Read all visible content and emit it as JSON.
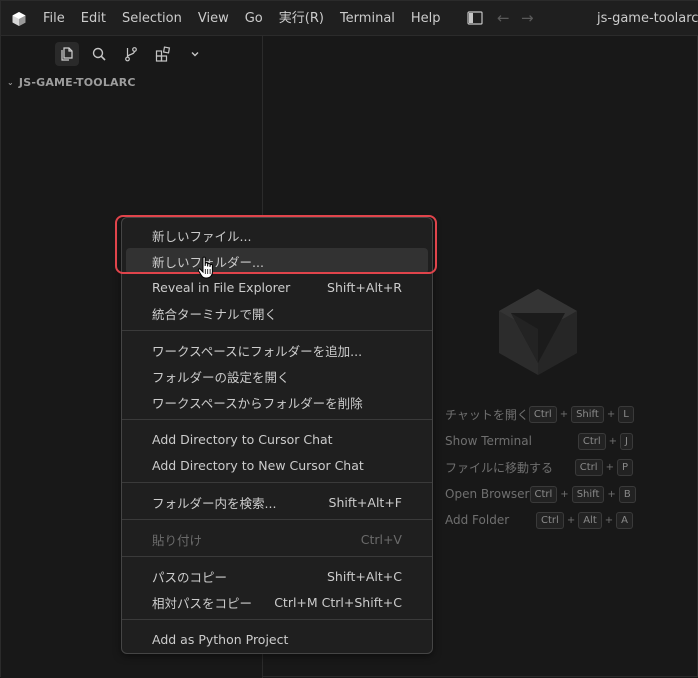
{
  "titlebar": {
    "menu": [
      "File",
      "Edit",
      "Selection",
      "View",
      "Go",
      "実行(R)",
      "Terminal",
      "Help"
    ],
    "back_arrow": "←",
    "forward_arrow": "→",
    "window_title": "js-game-toolarc"
  },
  "sidebar": {
    "activity_icons": [
      "explorer-icon",
      "search-icon",
      "source-control-icon",
      "extensions-icon",
      "chevron-down-icon"
    ],
    "explorer_title": "JS-GAME-TOOLARC",
    "explorer_chevron": "⌄"
  },
  "editor": {
    "shortcuts": [
      {
        "label": "チャットを開く",
        "keys": [
          "Ctrl",
          "Shift",
          "L"
        ]
      },
      {
        "label": "Show Terminal",
        "keys": [
          "Ctrl",
          "J"
        ]
      },
      {
        "label": "ファイルに移動する",
        "keys": [
          "Ctrl",
          "P"
        ]
      },
      {
        "label": "Open Browser",
        "keys": [
          "Ctrl",
          "Shift",
          "B"
        ]
      },
      {
        "label": "Add Folder",
        "keys": [
          "Ctrl",
          "Alt",
          "A"
        ]
      }
    ]
  },
  "context_menu": {
    "items": [
      {
        "label": "新しいファイル...",
        "shortcut": ""
      },
      {
        "label": "新しいフォルダー...",
        "shortcut": ""
      },
      {
        "label": "Reveal in File Explorer",
        "shortcut": "Shift+Alt+R"
      },
      {
        "label": "統合ターミナルで開く",
        "shortcut": ""
      },
      {
        "label": "ワークスペースにフォルダーを追加...",
        "shortcut": ""
      },
      {
        "label": "フォルダーの設定を開く",
        "shortcut": ""
      },
      {
        "label": "ワークスペースからフォルダーを削除",
        "shortcut": ""
      },
      {
        "label": "Add Directory to Cursor Chat",
        "shortcut": ""
      },
      {
        "label": "Add Directory to New Cursor Chat",
        "shortcut": ""
      },
      {
        "label": "フォルダー内を検索...",
        "shortcut": "Shift+Alt+F"
      },
      {
        "label": "貼り付け",
        "shortcut": "Ctrl+V"
      },
      {
        "label": "パスのコピー",
        "shortcut": "Shift+Alt+C"
      },
      {
        "label": "相対パスをコピー",
        "shortcut": "Ctrl+M Ctrl+Shift+C"
      },
      {
        "label": "Add as Python Project",
        "shortcut": ""
      }
    ],
    "hovered_item": "新しいフォルダー...",
    "disabled_item": "貼り付け"
  },
  "colors": {
    "background": "#181818",
    "titlebar": "#1f1f1f",
    "menu_background": "#1f1f1f",
    "menu_hover": "#323232",
    "highlight_annotation": "#e0444b",
    "text": "#cccccc"
  }
}
